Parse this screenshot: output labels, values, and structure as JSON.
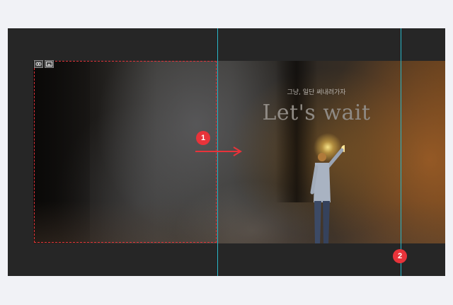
{
  "banner": {
    "subtitle": "그냥, 일단 써내려가자",
    "title": "Let's wait"
  },
  "markers": {
    "first": "1",
    "second": "2"
  },
  "icons": {
    "selection_tools": [
      "link-icon",
      "image-icon"
    ],
    "move_arrow": "right-arrow-icon"
  },
  "colors": {
    "page_background": "#f1f2f6",
    "canvas_background": "#262626",
    "selection_border": "#e0333a",
    "guide_line": "#29b6c8",
    "marker_fill": "#e8333a"
  }
}
